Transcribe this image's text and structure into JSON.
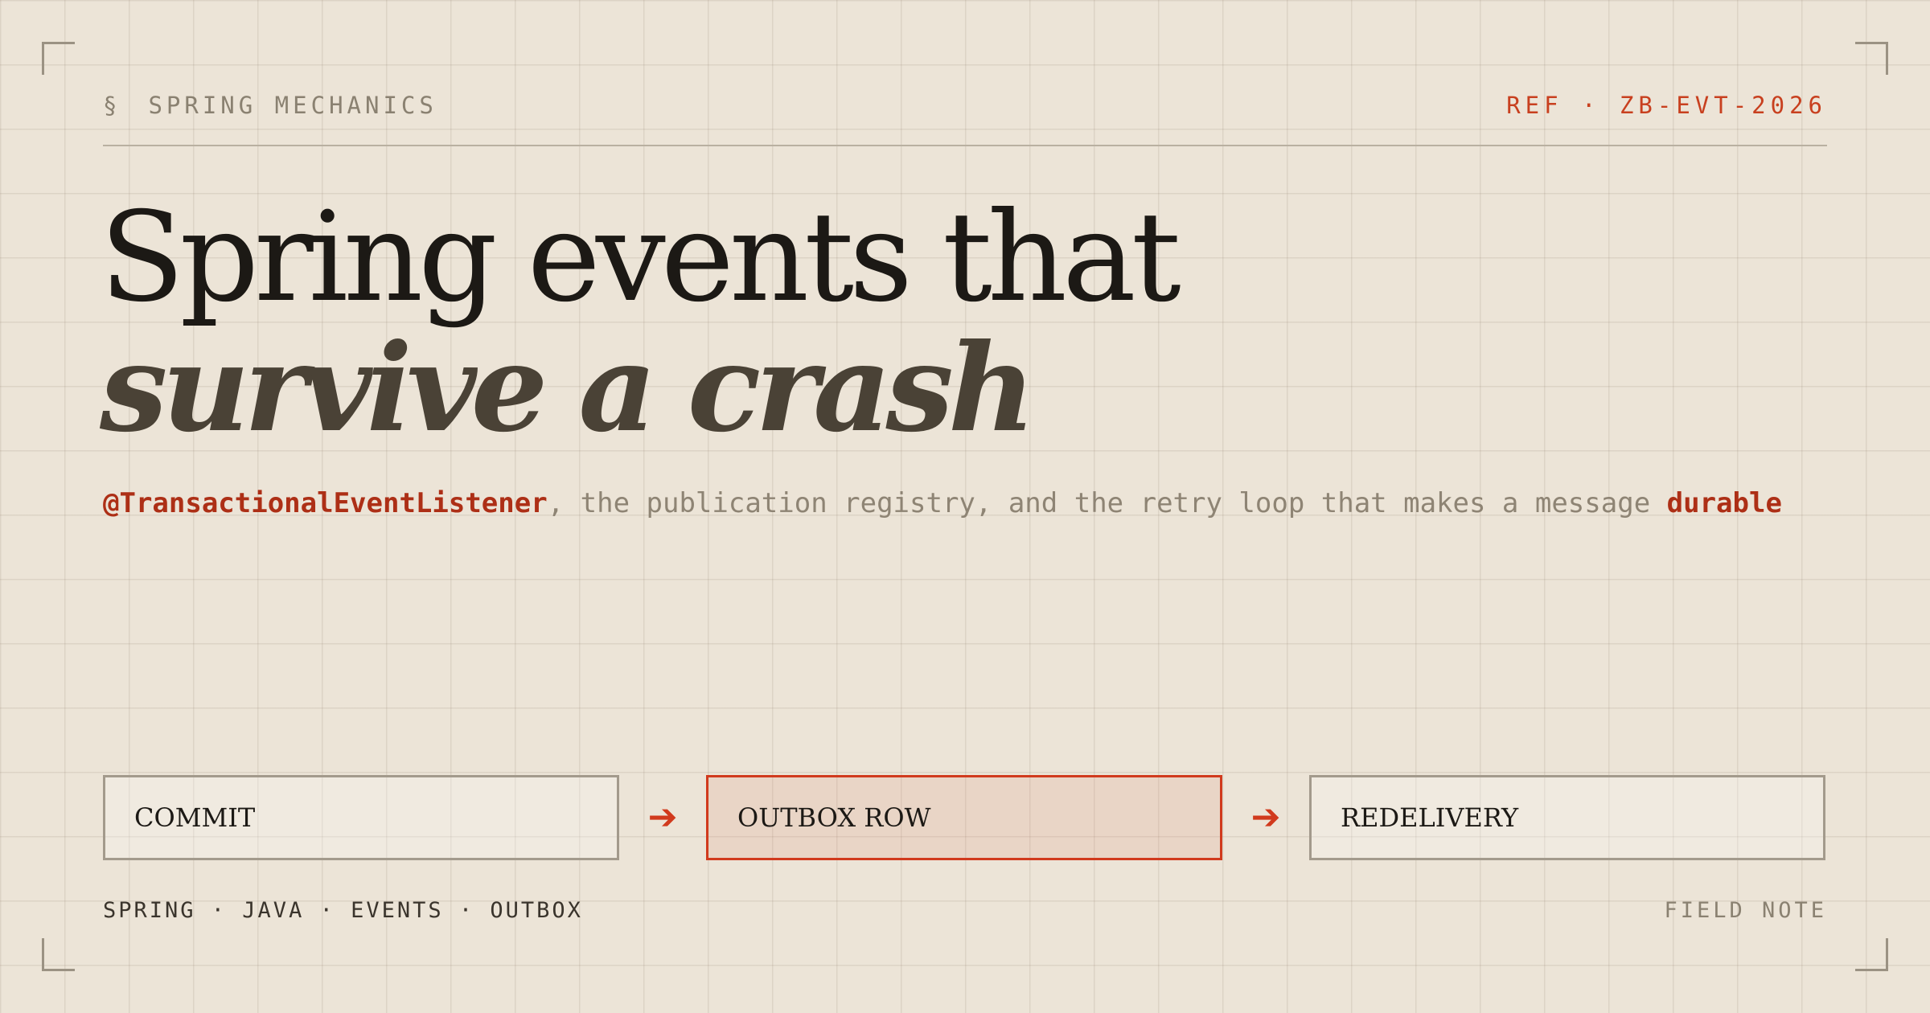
{
  "header": {
    "section_mark": "§",
    "section_label": "SPRING MECHANICS",
    "ref": "REF · ZB-EVT-2026"
  },
  "headline": {
    "line1": "Spring events that",
    "line2": "survive a crash"
  },
  "subtitle": {
    "lead": "@TransactionalEventListener",
    "middle": ", the publication registry, and the retry loop that makes a message ",
    "tail": "durable"
  },
  "flow": {
    "steps": [
      {
        "label": "COMMIT",
        "highlighted": false
      },
      {
        "label": "OUTBOX ROW",
        "highlighted": true
      },
      {
        "label": "REDELIVERY",
        "highlighted": false
      }
    ],
    "arrow_glyph": "➔",
    "icons": [
      "arrow-right-icon"
    ]
  },
  "footer": {
    "tags": "SPRING · JAVA · EVENTS · OUTBOX",
    "note": "FIELD NOTE"
  },
  "colors": {
    "background": "#ece4d7",
    "accent": "#d13a1d",
    "ink": "#1c1915",
    "muted": "#8a8171"
  }
}
